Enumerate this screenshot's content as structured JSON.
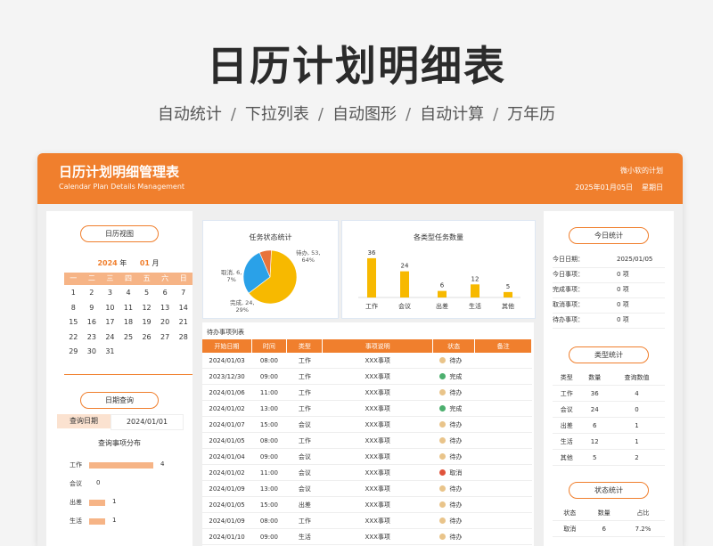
{
  "hero": {
    "title": "日历计划明细表",
    "features": [
      "自动统计",
      "下拉列表",
      "自动图形",
      "自动计算",
      "万年历"
    ],
    "separator": "/"
  },
  "header": {
    "title": "日历计划明细管理表",
    "subtitle": "Calendar Plan Details Management",
    "owner": "微小软的计划",
    "date": "2025年01月05日",
    "weekday": "星期日"
  },
  "calendar": {
    "title": "日历视图",
    "year": "2024",
    "year_suffix": "年",
    "month": "01",
    "month_suffix": "月",
    "weekdays": [
      "一",
      "二",
      "三",
      "四",
      "五",
      "六",
      "日"
    ],
    "days": [
      "1",
      "2",
      "3",
      "4",
      "5",
      "6",
      "7",
      "8",
      "9",
      "10",
      "11",
      "12",
      "13",
      "14",
      "15",
      "16",
      "17",
      "18",
      "19",
      "20",
      "21",
      "22",
      "23",
      "24",
      "25",
      "26",
      "27",
      "28",
      "29",
      "30",
      "31"
    ]
  },
  "query": {
    "title": "日期查询",
    "label": "查询日期",
    "value": "2024/01/01",
    "dist_title": "查询事项分布",
    "bars": [
      {
        "name": "工作",
        "value": 4
      },
      {
        "name": "会议",
        "value": 0
      },
      {
        "name": "出差",
        "value": 1
      },
      {
        "name": "生活",
        "value": 1
      }
    ]
  },
  "pie": {
    "title": "任务状态统计",
    "labels": [
      {
        "text": "待办, 53,",
        "pct": "64%"
      },
      {
        "text": "取消, 6,",
        "pct": "7%"
      },
      {
        "text": "完成, 24,",
        "pct": "29%"
      }
    ],
    "slices": [
      {
        "name": "待办",
        "value": 53,
        "color": "#f7b900"
      },
      {
        "name": "完成",
        "value": 24,
        "color": "#2aa1e8"
      },
      {
        "name": "取消",
        "value": 6,
        "color": "#e8743b"
      }
    ]
  },
  "chart_data": {
    "type": "bar",
    "title": "各类型任务数量",
    "categories": [
      "工作",
      "会议",
      "出差",
      "生活",
      "其他"
    ],
    "values": [
      36,
      24,
      6,
      12,
      5
    ],
    "ylim": [
      0,
      40
    ],
    "color": "#f7b900"
  },
  "tasks": {
    "title": "待办事项列表",
    "columns": [
      "开始日期",
      "时间",
      "类型",
      "事项说明",
      "状态",
      "备注"
    ],
    "rows": [
      {
        "date": "2024/01/03",
        "time": "08:00",
        "type": "工作",
        "desc": "XXX事项",
        "status": "待办",
        "color": "#e9c48a"
      },
      {
        "date": "2023/12/30",
        "time": "09:00",
        "type": "工作",
        "desc": "XXX事项",
        "status": "完成",
        "color": "#4caf6e"
      },
      {
        "date": "2024/01/06",
        "time": "11:00",
        "type": "工作",
        "desc": "XXX事项",
        "status": "待办",
        "color": "#e9c48a"
      },
      {
        "date": "2024/01/02",
        "time": "13:00",
        "type": "工作",
        "desc": "XXX事项",
        "status": "完成",
        "color": "#4caf6e"
      },
      {
        "date": "2024/01/07",
        "time": "15:00",
        "type": "会议",
        "desc": "XXX事项",
        "status": "待办",
        "color": "#e9c48a"
      },
      {
        "date": "2024/01/05",
        "time": "08:00",
        "type": "工作",
        "desc": "XXX事项",
        "status": "待办",
        "color": "#e9c48a"
      },
      {
        "date": "2024/01/04",
        "time": "09:00",
        "type": "会议",
        "desc": "XXX事项",
        "status": "待办",
        "color": "#e9c48a"
      },
      {
        "date": "2024/01/02",
        "time": "11:00",
        "type": "会议",
        "desc": "XXX事项",
        "status": "取消",
        "color": "#e0533b"
      },
      {
        "date": "2024/01/09",
        "time": "13:00",
        "type": "会议",
        "desc": "XXX事项",
        "status": "待办",
        "color": "#e9c48a"
      },
      {
        "date": "2024/01/05",
        "time": "15:00",
        "type": "出差",
        "desc": "XXX事项",
        "status": "待办",
        "color": "#e9c48a"
      },
      {
        "date": "2024/01/09",
        "time": "08:00",
        "type": "工作",
        "desc": "XXX事项",
        "status": "待办",
        "color": "#e9c48a"
      },
      {
        "date": "2024/01/10",
        "time": "09:00",
        "type": "生活",
        "desc": "XXX事项",
        "status": "待办",
        "color": "#e9c48a"
      }
    ]
  },
  "today": {
    "title": "今日统计",
    "items": [
      {
        "k": "今日日期：",
        "v": "2025/01/05"
      },
      {
        "k": "今日事项：",
        "v": "0 项"
      },
      {
        "k": "完成事项：",
        "v": "0 项"
      },
      {
        "k": "取消事项：",
        "v": "0 项"
      },
      {
        "k": "待办事项：",
        "v": "0 项"
      }
    ]
  },
  "type_stats": {
    "title": "类型统计",
    "columns": [
      "类型",
      "数量",
      "查询数值"
    ],
    "rows": [
      [
        "工作",
        "36",
        "4"
      ],
      [
        "会议",
        "24",
        "0"
      ],
      [
        "出差",
        "6",
        "1"
      ],
      [
        "生活",
        "12",
        "1"
      ],
      [
        "其他",
        "5",
        "2"
      ]
    ]
  },
  "status_stats": {
    "title": "状态统计",
    "columns": [
      "状态",
      "数量",
      "占比"
    ],
    "rows": [
      [
        "取消",
        "6",
        "7.2%"
      ]
    ]
  }
}
